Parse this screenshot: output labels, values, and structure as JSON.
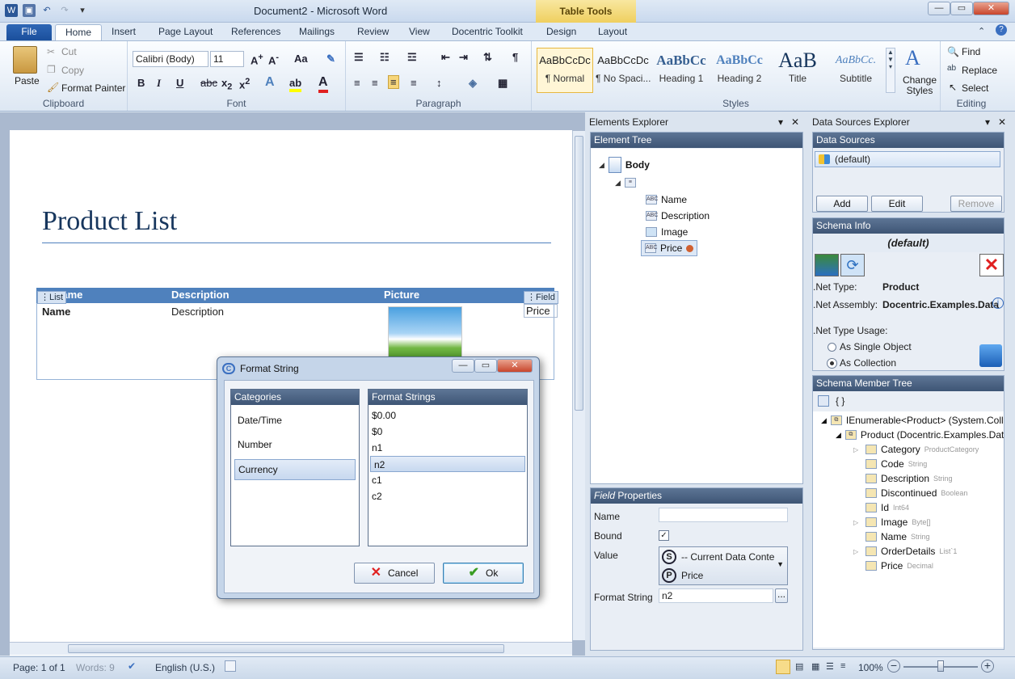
{
  "window": {
    "title": "Document2 - Microsoft Word",
    "contextual_tab_group": "Table Tools"
  },
  "ribbon": {
    "tabs": [
      "File",
      "Home",
      "Insert",
      "Page Layout",
      "References",
      "Mailings",
      "Review",
      "View",
      "Docentric Toolkit",
      "Design",
      "Layout"
    ],
    "clipboard": {
      "paste": "Paste",
      "cut": "Cut",
      "copy": "Copy",
      "format_painter": "Format Painter",
      "group": "Clipboard"
    },
    "font": {
      "name": "Calibri (Body)",
      "size": "11",
      "group": "Font"
    },
    "paragraph": {
      "group": "Paragraph"
    },
    "styles": {
      "items": [
        {
          "sample": "AaBbCcDc",
          "name": "¶ Normal"
        },
        {
          "sample": "AaBbCcDc",
          "name": "¶ No Spaci..."
        },
        {
          "sample": "AaBbCc",
          "name": "Heading 1"
        },
        {
          "sample": "AaBbCc",
          "name": "Heading 2"
        },
        {
          "sample": "AaB",
          "name": "Title"
        },
        {
          "sample": "AaBbCc.",
          "name": "Subtitle"
        }
      ],
      "change_styles": "Change Styles",
      "group": "Styles"
    },
    "editing": {
      "find": "Find",
      "replace": "Replace",
      "select": "Select",
      "group": "Editing"
    }
  },
  "document": {
    "title": "Product List",
    "table_headers": [
      "Name",
      "Description",
      "Picture"
    ],
    "list_tag": "List",
    "field_tag": "Field",
    "row": {
      "name": "Name",
      "description": "Description",
      "price": "Price"
    }
  },
  "elements_explorer": {
    "title": "Elements Explorer",
    "tree_header": "Element Tree",
    "root": "Body",
    "children": [
      "Name",
      "Description",
      "Image",
      "Price"
    ],
    "properties_header_italic": "Field",
    "properties_header": "Properties",
    "labels": {
      "name": "Name",
      "bound": "Bound",
      "value": "Value",
      "format_string": "Format String"
    },
    "value_context": "-- Current Data Conte",
    "value_path": "Price",
    "format_string_value": "n2"
  },
  "data_sources_explorer": {
    "title": "Data Sources Explorer",
    "data_sources_header": "Data Sources",
    "default_source": "(default)",
    "buttons": {
      "add": "Add",
      "edit": "Edit",
      "remove": "Remove"
    },
    "schema_info_header": "Schema Info",
    "schema_name": "(default)",
    "net_type_label": ".Net Type:",
    "net_type": "Product",
    "net_assembly_label": ".Net Assembly:",
    "net_assembly": "Docentric.Examples.Data",
    "usage_label": ".Net Type Usage:",
    "usage_single": "As Single Object",
    "usage_collection": "As Collection",
    "member_tree_header": "Schema Member Tree",
    "tree_root": "IEnumerable<Product> (System.Colle",
    "tree_product": "Product (Docentric.Examples.Data",
    "members": [
      {
        "name": "Category",
        "type": "ProductCategory"
      },
      {
        "name": "Code",
        "type": "String"
      },
      {
        "name": "Description",
        "type": "String"
      },
      {
        "name": "Discontinued",
        "type": "Boolean"
      },
      {
        "name": "Id",
        "type": "Int64"
      },
      {
        "name": "Image",
        "type": "Byte[]"
      },
      {
        "name": "Name",
        "type": "String"
      },
      {
        "name": "OrderDetails",
        "type": "List`1"
      },
      {
        "name": "Price",
        "type": "Decimal"
      }
    ]
  },
  "dialog": {
    "title": "Format String",
    "categories_header": "Categories",
    "categories": [
      "Date/Time",
      "Number",
      "Currency"
    ],
    "selected_category": "Currency",
    "formats_header": "Format Strings",
    "formats": [
      "$0.00",
      "$0",
      "n1",
      "n2",
      "c1",
      "c2"
    ],
    "selected_format": "n2",
    "cancel": "Cancel",
    "ok": "Ok"
  },
  "status": {
    "page": "Page: 1 of 1",
    "words": "Words: 9",
    "language": "English (U.S.)",
    "zoom": "100%"
  },
  "colors": {
    "accent": "#4f81bd",
    "title_text": "#17365d",
    "panel_header": "#3e5575"
  }
}
